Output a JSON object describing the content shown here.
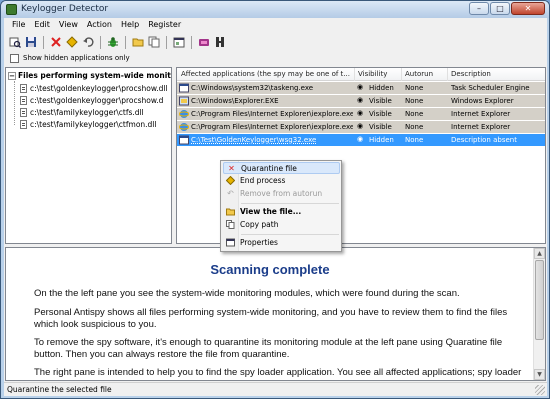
{
  "window": {
    "title": "Keylogger Detector",
    "caption_min": "–",
    "caption_max": "□",
    "caption_close": "✕"
  },
  "menu": [
    "File",
    "Edit",
    "View",
    "Action",
    "Help",
    "Register"
  ],
  "toolbar": {
    "icons": [
      "scan-icon",
      "save-icon",
      "quarantine-icon",
      "end-process-icon",
      "undo-icon",
      "bug-icon",
      "view-file-icon",
      "copy-icon",
      "properties-icon",
      "tools-icon",
      "help-icon"
    ]
  },
  "checkbox": {
    "label": "Show hidden applications only",
    "checked": false
  },
  "left_pane": {
    "root_label": "Files performing system-wide monitoring",
    "root_expander": "−",
    "items": [
      "c:\\test\\goldenkeylogger\\procshow.dll",
      "c:\\test\\goldenkeylogger\\procshow.d",
      "c:\\test\\familykeylogger\\ctfs.dll",
      "c:\\test\\familykeylogger\\ctfmon.dll"
    ]
  },
  "right_pane": {
    "columns": [
      "Affected applications (the spy may be one of t...",
      "Visibility",
      "Autorun",
      "Description"
    ],
    "rows": [
      {
        "path": "C:\\Windows\\system32\\taskeng.exe",
        "visibility": "Hidden",
        "autorun": "None",
        "description": "Task Scheduler Engine",
        "icon": "app-icon",
        "selected": false
      },
      {
        "path": "C:\\Windows\\Explorer.EXE",
        "visibility": "Visible",
        "autorun": "None",
        "description": "Windows Explorer",
        "icon": "explorer-icon",
        "selected": false
      },
      {
        "path": "C:\\Program Files\\Internet Explorer\\iexplore.exe",
        "visibility": "Visible",
        "autorun": "None",
        "description": "Internet Explorer",
        "icon": "ie-icon",
        "selected": false
      },
      {
        "path": "C:\\Program Files\\Internet Explorer\\iexplore.exe",
        "visibility": "Visible",
        "autorun": "None",
        "description": "Internet Explorer",
        "icon": "ie-icon",
        "selected": false
      },
      {
        "path": "C:\\Test\\GoldenKeylogger\\wsg32.exe",
        "visibility": "Hidden",
        "autorun": "None",
        "description": "Description absent",
        "icon": "app-icon",
        "selected": true
      }
    ]
  },
  "context_menu": {
    "items": [
      {
        "label": "Quarantine file",
        "icon": "quarantine-x-icon",
        "highlighted": true,
        "disabled": false
      },
      {
        "label": "End process",
        "icon": "end-process-icon",
        "highlighted": false,
        "disabled": false
      },
      {
        "label": "Remove from autorun",
        "icon": "undo-icon",
        "highlighted": false,
        "disabled": true
      },
      {
        "label": "View the file...",
        "icon": "view-file-icon",
        "highlighted": false,
        "disabled": false
      },
      {
        "label": "Copy path",
        "icon": "copy-icon",
        "highlighted": false,
        "disabled": false
      },
      {
        "label": "Properties",
        "icon": "properties-icon",
        "highlighted": false,
        "disabled": false
      }
    ]
  },
  "info": {
    "title": "Scanning complete",
    "p1": "On the the left pane you see the system-wide monitoring modules, which were found during the scan.",
    "p2": "Personal Antispy shows all files performing system-wide monitoring, and you have to review them to find the files which look suspicious to you.",
    "p3": "To remove the spy software, it's enough to quarantine its monitoring module at the left pane using Quaratine file button. Then you can always restore the file from quarantine.",
    "p4": "The right pane is intended to help you to find the spy loader application. You see all affected applications; spy loader is one of them. You can use the alert level table to find the loader of the monitoring module."
  },
  "status": {
    "text": "Quarantine the selected file"
  },
  "colors": {
    "selection": "#3399ff",
    "row_gray": "#d4d0c8",
    "info_title": "#1b3d8a"
  }
}
